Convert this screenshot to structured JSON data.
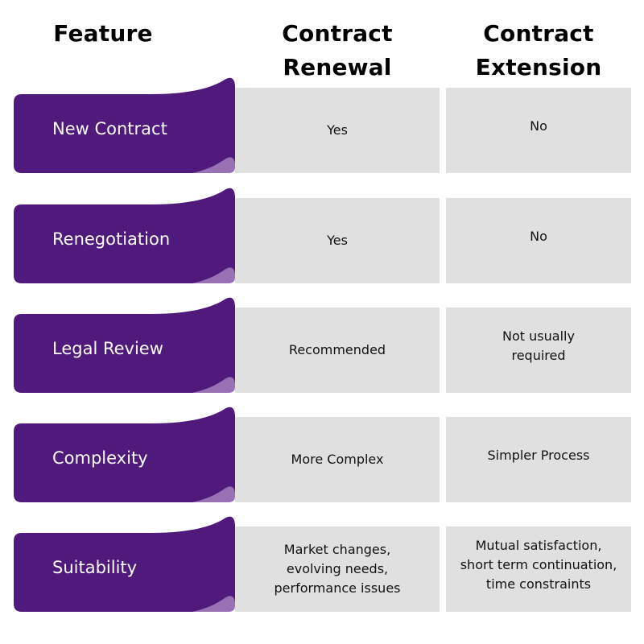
{
  "colors": {
    "tab_purple": "#4f1a7c",
    "tab_curl": "#9870b4",
    "cell_gray": "#e0e0e0",
    "header_text": "#000000",
    "cell_text": "#111111"
  },
  "header": {
    "feature": "Feature",
    "renewal": "Contract\nRenewal",
    "extension": "Contract\nExtension"
  },
  "rows": [
    {
      "feature": "New Contract",
      "renewal": "Yes",
      "extension": "No"
    },
    {
      "feature": "Renegotiation",
      "renewal": "Yes",
      "extension": "No"
    },
    {
      "feature": "Legal Review",
      "renewal": "Recommended",
      "extension": "Not usually\nrequired"
    },
    {
      "feature": "Complexity",
      "renewal": "More Complex",
      "extension": "Simpler Process"
    },
    {
      "feature": "Suitability",
      "renewal": "Market changes,\nevolving needs,\nperformance issues",
      "extension": "Mutual satisfaction,\nshort term continuation,\ntime constraints"
    }
  ]
}
